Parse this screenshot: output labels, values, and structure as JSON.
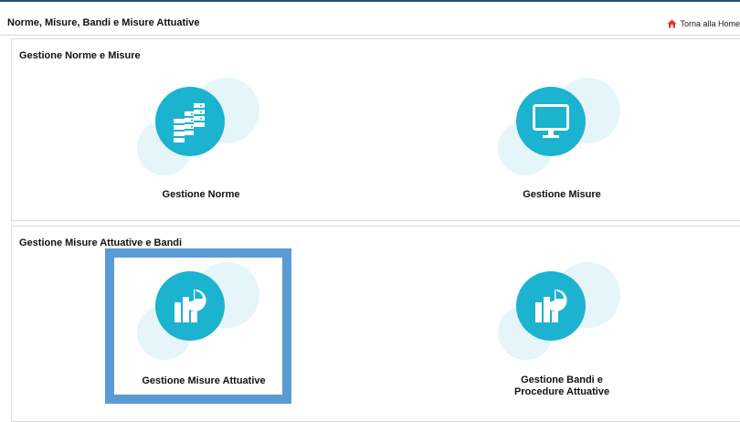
{
  "header": {
    "title": "Norme, Misure, Bandi e Misure Attuative",
    "home_link": "Torna alla Home"
  },
  "sections": [
    {
      "title": "Gestione Norme e Misure",
      "tiles": [
        {
          "label": "Gestione Norme",
          "icon": "server-stack-icon"
        },
        {
          "label": "Gestione Misure",
          "icon": "monitor-icon"
        }
      ]
    },
    {
      "title": "Gestione Misure Attuative e Bandi",
      "tiles": [
        {
          "label": "Gestione Misure Attuative",
          "icon": "chart-report-icon",
          "selected": true
        },
        {
          "label_line1": "Gestione Bandi e",
          "label_line2": "Procedure Attuative",
          "icon": "chart-report-icon"
        }
      ]
    }
  ],
  "colors": {
    "accent": "#1bb3cf",
    "bubble": "#e5f5f9",
    "selection": "#5b9bd5",
    "home_icon": "#d9382a"
  }
}
